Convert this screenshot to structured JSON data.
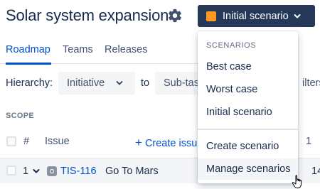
{
  "header": {
    "title": "Solar system expansion",
    "settings_icon": "gear-icon"
  },
  "scenario_button": {
    "label": "Initial scenario",
    "swatch_color": "#FF991F",
    "icon": "chevron-down-icon"
  },
  "tabs": [
    {
      "label": "Roadmap",
      "active": true
    },
    {
      "label": "Teams",
      "active": false
    },
    {
      "label": "Releases",
      "active": false
    }
  ],
  "hierarchy": {
    "label": "Hierarchy:",
    "from_value": "Initiative",
    "to_label": "to",
    "to_value": "Sub-tas",
    "filters_label": "ilters"
  },
  "scope": {
    "heading": "SCOPE",
    "columns": {
      "hash": "#",
      "issue": "Issue",
      "create_issue": "Create issu",
      "right_col": "1"
    },
    "rows": [
      {
        "number": "1",
        "key": "TIS-116",
        "summary": "Go To Mars",
        "right": "14"
      }
    ]
  },
  "dropdown": {
    "heading": "SCENARIOS",
    "scenarios": [
      "Best case",
      "Worst case",
      "Initial scenario"
    ],
    "actions": [
      "Create scenario",
      "Manage scenarios"
    ],
    "hovered": "Manage scenarios"
  },
  "colors": {
    "accent": "#0052CC",
    "button_bg": "#253858",
    "swatch": "#FF991F"
  }
}
